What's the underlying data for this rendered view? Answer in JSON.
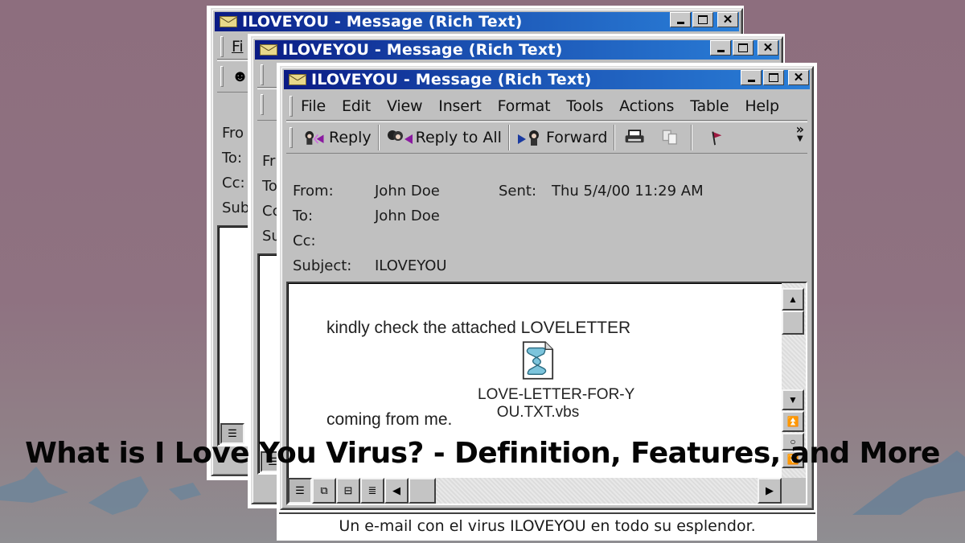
{
  "headline": "What is I Love You Virus? - Definition, Features, and More",
  "caption": "Un e-mail con el virus ILOVEYOU en todo su esplendor.",
  "colors": {
    "background_top": "#8d6e7e",
    "background_bottom": "#8f8e92",
    "titlebar_dark": "#0a1a84",
    "titlebar_light": "#2a7fd8",
    "window_face": "#c0c0c0",
    "flag": "#a01840"
  },
  "windows": [
    {
      "title": "ILOVEYOU - Message (Rich Text)",
      "menu_partial": "Fi",
      "header_partials": [
        "Fro",
        "To:",
        "Cc:",
        "Sub"
      ]
    },
    {
      "title": "ILOVEYOU - Message (Rich Text)",
      "header_partials": [
        "Fr",
        "To",
        "Cc",
        "Su"
      ]
    },
    {
      "title": "ILOVEYOU - Message (Rich Text)",
      "title_icon": "envelope-icon",
      "controls": [
        "minimize",
        "maximize",
        "close"
      ],
      "menu": [
        {
          "label": "File"
        },
        {
          "label": "Edit"
        },
        {
          "label": "View"
        },
        {
          "label": "Insert"
        },
        {
          "label": "Format"
        },
        {
          "label": "Tools"
        },
        {
          "label": "Actions"
        },
        {
          "label": "Table"
        },
        {
          "label": "Help"
        }
      ],
      "toolbar": {
        "reply": "Reply",
        "reply_all": "Reply to All",
        "forward": "Forward",
        "overflow": "»"
      },
      "headers": {
        "from_label": "From:",
        "from_value": "John Doe",
        "sent_label": "Sent:",
        "sent_value": "Thu 5/4/00 11:29 AM",
        "to_label": "To:",
        "to_value": "John Doe",
        "cc_label": "Cc:",
        "cc_value": "",
        "subject_label": "Subject:",
        "subject_value": "ILOVEYOU"
      },
      "body": {
        "line1": "kindly check the attached LOVELETTER",
        "line2": "coming from me.",
        "attachment_name_line1": "LOVE-LETTER-FOR-Y",
        "attachment_name_line2": "OU.TXT.vbs",
        "attachment_icon": "vbs-script-icon"
      }
    }
  ]
}
